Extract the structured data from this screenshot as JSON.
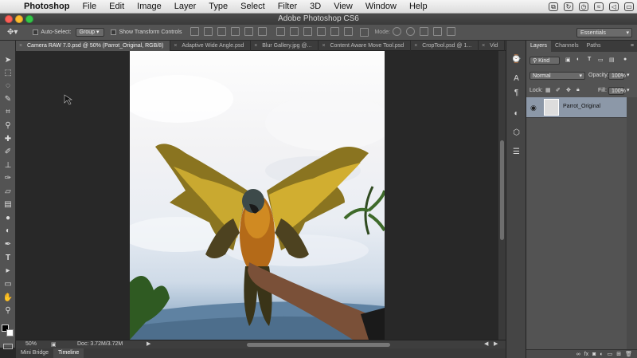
{
  "menubar": {
    "app": "Photoshop",
    "items": [
      "File",
      "Edit",
      "Image",
      "Layer",
      "Type",
      "Select",
      "Filter",
      "3D",
      "View",
      "Window",
      "Help"
    ]
  },
  "window": {
    "title": "Adobe Photoshop CS6"
  },
  "options_bar": {
    "auto_select_label": "Auto-Select:",
    "auto_select_value": "Group",
    "transform_controls_label": "Show Transform Controls",
    "mode_label": "Mode:",
    "workspace": "Essentials"
  },
  "tabs": [
    {
      "label": "Camera RAW 7.0.psd @ 50% (Parrot_Original, RGB/8)",
      "active": true
    },
    {
      "label": "Adaptive Wide Angle.psd",
      "active": false
    },
    {
      "label": "Blur Gallery.jpg @...",
      "active": false
    },
    {
      "label": "Content Aware Move Tool.psd",
      "active": false
    },
    {
      "label": "CropTool.psd @ 1...",
      "active": false
    },
    {
      "label": "Vid",
      "active": false
    }
  ],
  "status": {
    "zoom": "50%",
    "doc": "Doc: 3.72M/3.72M"
  },
  "bottom_tabs": [
    {
      "label": "Mini Bridge",
      "active": false
    },
    {
      "label": "Timeline",
      "active": true
    }
  ],
  "layers_panel": {
    "tabs": [
      {
        "label": "Layers",
        "active": true
      },
      {
        "label": "Channels",
        "active": false
      },
      {
        "label": "Paths",
        "active": false
      }
    ],
    "kind_filter": "Kind",
    "blend_mode": "Normal",
    "opacity_label": "Opacity:",
    "opacity": "100%",
    "lock_label": "Lock:",
    "fill_label": "Fill:",
    "fill": "100%",
    "layers": [
      {
        "name": "Parrot_Original",
        "visible": true,
        "selected": true
      }
    ]
  },
  "colors": {
    "accent_selection": "#8c98a8",
    "panel_bg": "#535353",
    "workspace_bg": "#282828"
  }
}
